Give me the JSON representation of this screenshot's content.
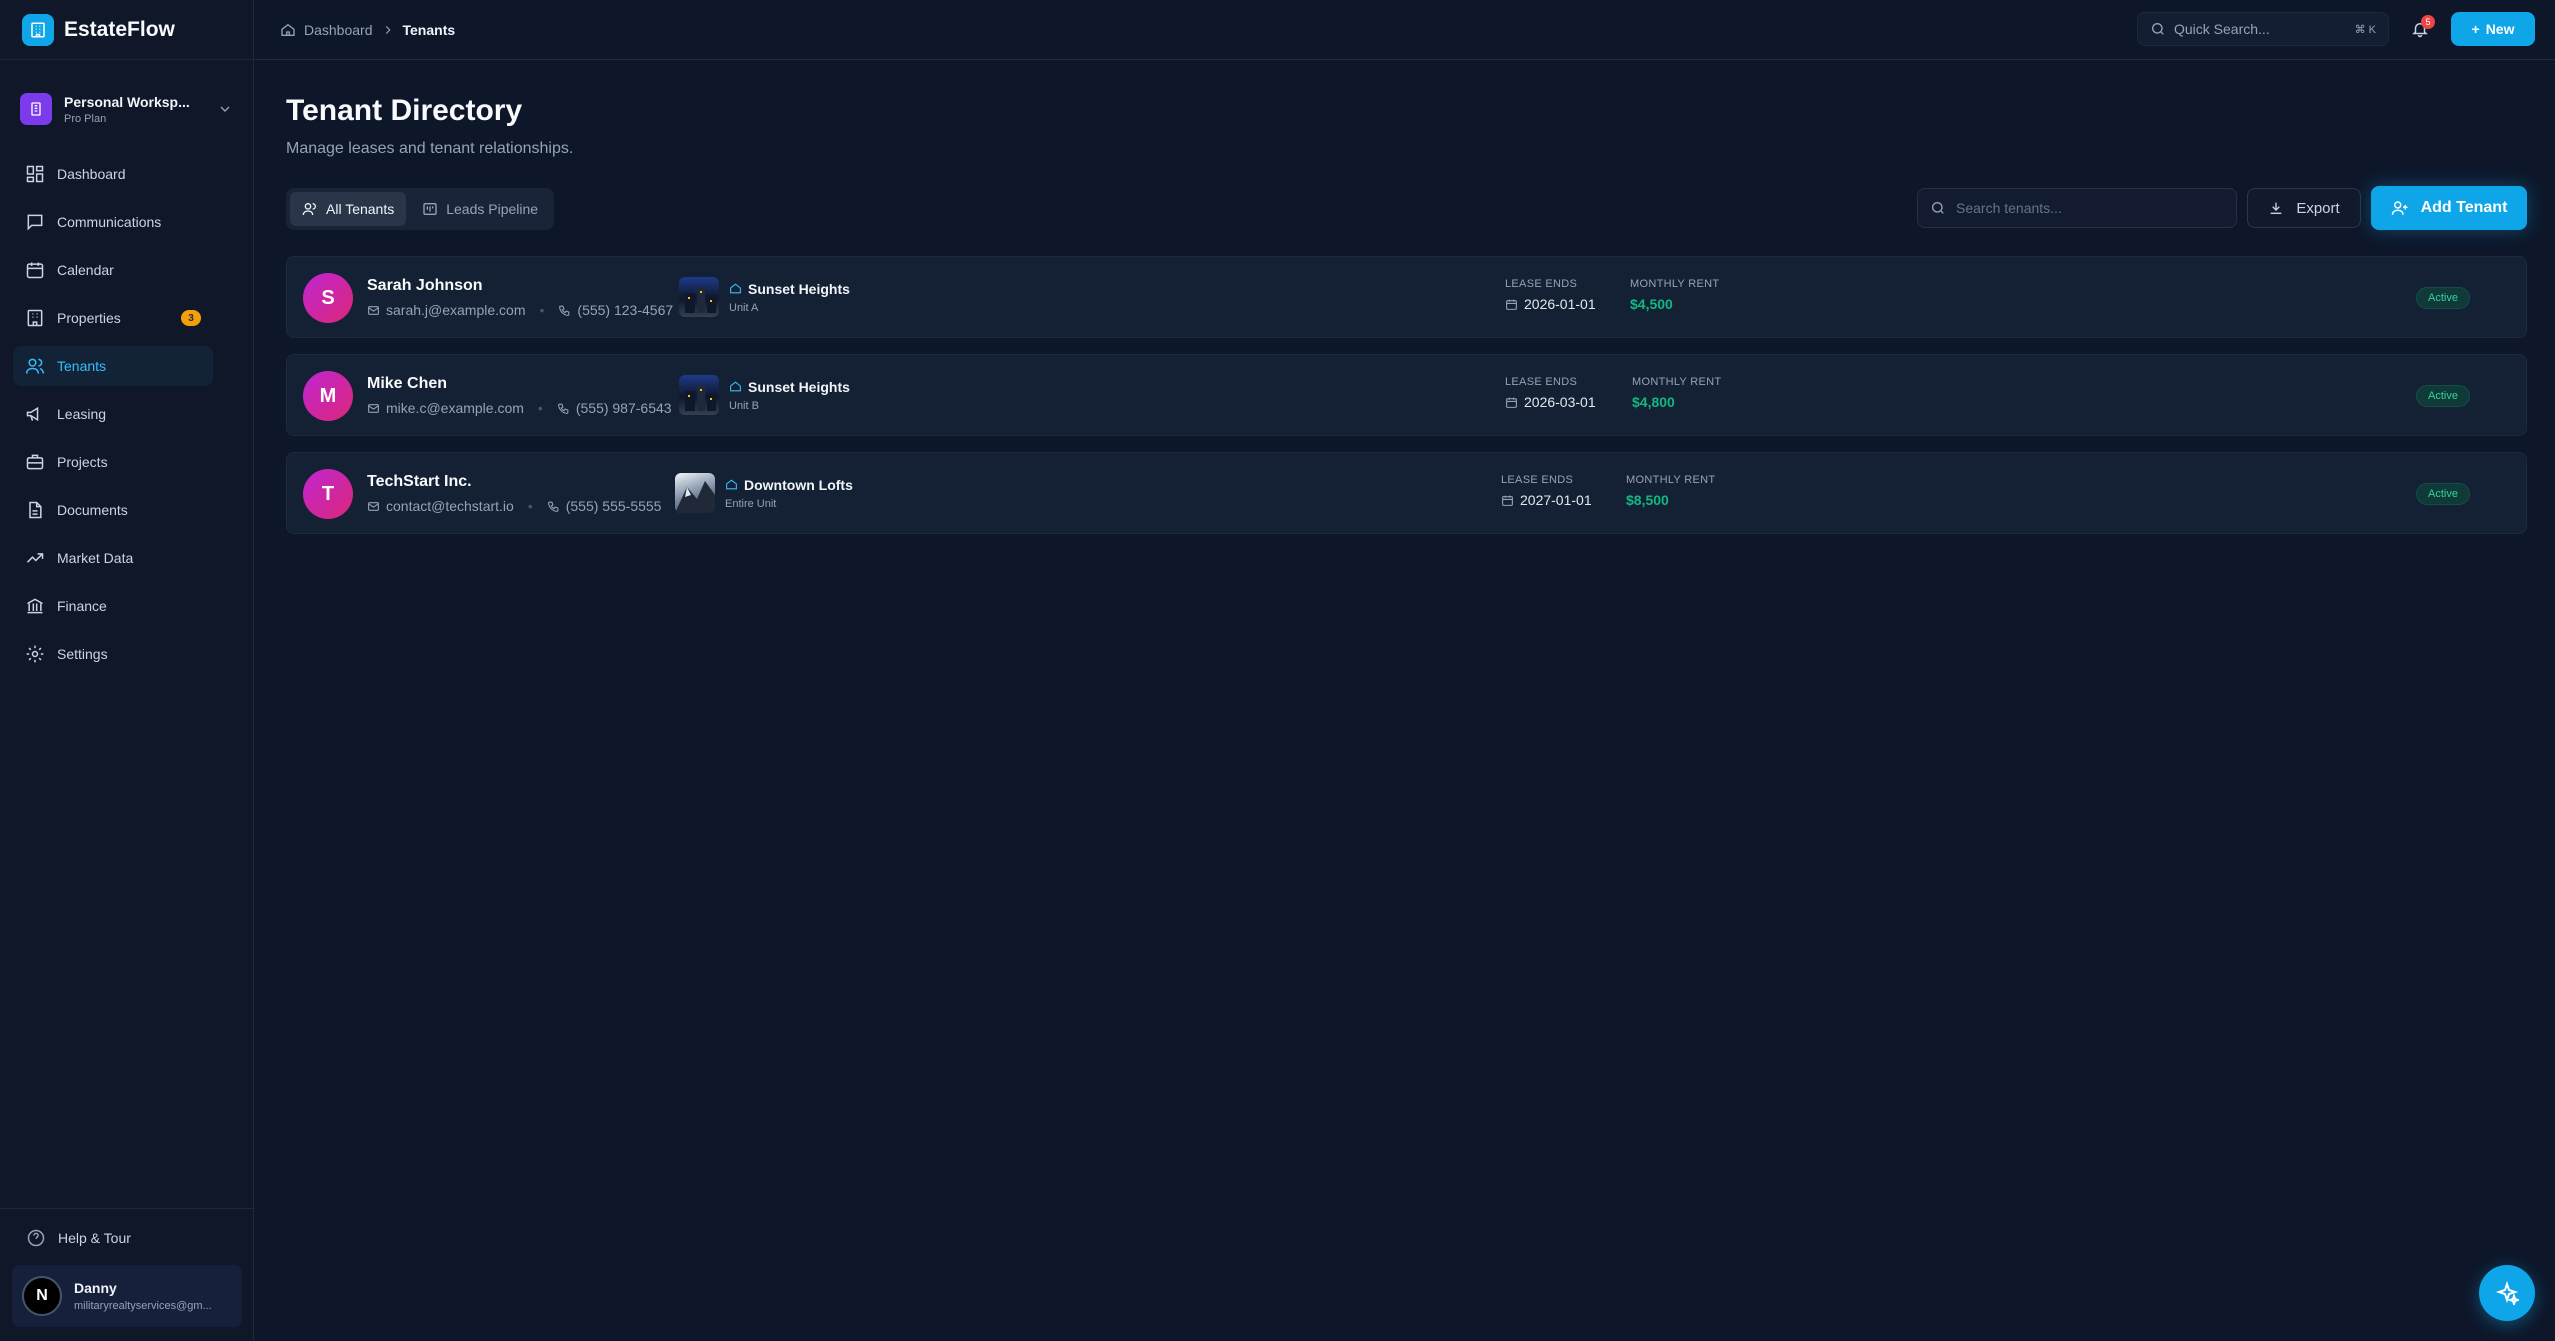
{
  "app": {
    "name": "EstateFlow"
  },
  "workspace": {
    "name": "Personal Worksp...",
    "plan": "Pro Plan"
  },
  "sidebar": {
    "items": [
      {
        "label": "Dashboard",
        "icon": "dashboard-icon"
      },
      {
        "label": "Communications",
        "icon": "message-icon"
      },
      {
        "label": "Calendar",
        "icon": "calendar-icon"
      },
      {
        "label": "Properties",
        "icon": "building-icon",
        "badge": "3"
      },
      {
        "label": "Tenants",
        "icon": "users-icon",
        "active": true
      },
      {
        "label": "Leasing",
        "icon": "megaphone-icon"
      },
      {
        "label": "Projects",
        "icon": "briefcase-icon"
      },
      {
        "label": "Documents",
        "icon": "document-icon"
      },
      {
        "label": "Market Data",
        "icon": "trending-up-icon"
      },
      {
        "label": "Finance",
        "icon": "bank-icon"
      },
      {
        "label": "Settings",
        "icon": "gear-icon"
      }
    ],
    "help": "Help & Tour",
    "user": {
      "initial": "N",
      "name": "Danny",
      "email": "militaryrealtyservices@gm..."
    }
  },
  "topbar": {
    "breadcrumb": {
      "home": "Dashboard",
      "current": "Tenants"
    },
    "quick_search": "Quick Search...",
    "shortcut": "⌘ K",
    "notifications": "5",
    "new_label": "New"
  },
  "page": {
    "title": "Tenant Directory",
    "subtitle": "Manage leases and tenant relationships.",
    "tabs": [
      {
        "label": "All Tenants",
        "active": true
      },
      {
        "label": "Leads Pipeline"
      }
    ],
    "search_placeholder": "Search tenants...",
    "export_label": "Export",
    "add_label": "Add Tenant"
  },
  "labels": {
    "lease_ends": "LEASE ENDS",
    "monthly_rent": "MONTHLY RENT"
  },
  "tenants": [
    {
      "initial": "S",
      "name": "Sarah Johnson",
      "email": "sarah.j@example.com",
      "phone": "(555) 123-4567",
      "property": "Sunset Heights",
      "unit": "Unit A",
      "lease_ends": "2026-01-01",
      "rent": "$4,500",
      "status": "Active"
    },
    {
      "initial": "M",
      "name": "Mike Chen",
      "email": "mike.c@example.com",
      "phone": "(555) 987-6543",
      "property": "Sunset Heights",
      "unit": "Unit B",
      "lease_ends": "2026-03-01",
      "rent": "$4,800",
      "status": "Active"
    },
    {
      "initial": "T",
      "name": "TechStart Inc.",
      "email": "contact@techstart.io",
      "phone": "(555) 555-5555",
      "property": "Downtown Lofts",
      "unit": "Entire Unit",
      "lease_ends": "2027-01-01",
      "rent": "$8,500",
      "status": "Active"
    }
  ],
  "colors": {
    "accent": "#0ea5e9",
    "background": "#0e172a",
    "success": "#10b981",
    "badge": "#f59e0b"
  }
}
